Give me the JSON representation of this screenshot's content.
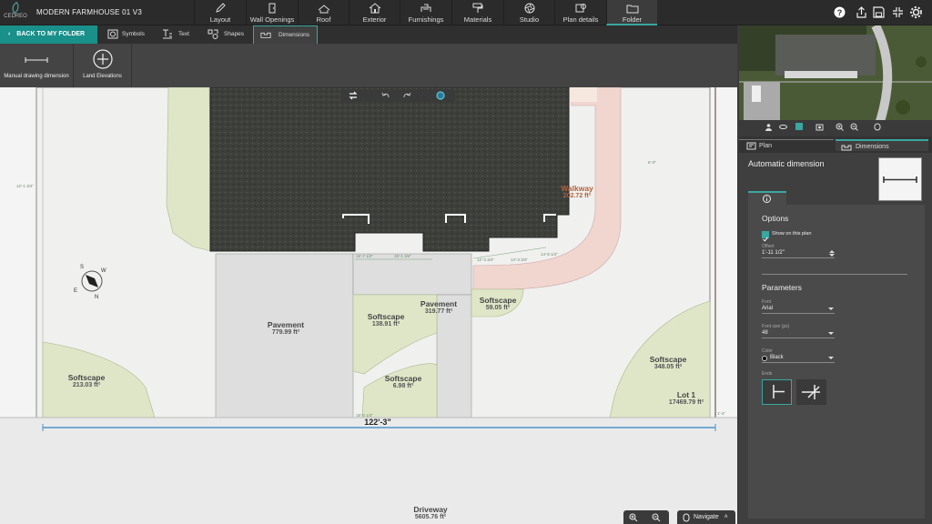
{
  "app": {
    "logo_text": "CEDREO",
    "project_name": "MODERN FARMHOUSE 01 V3"
  },
  "main_tabs": [
    {
      "label": "Layout",
      "icon": "pencil-icon"
    },
    {
      "label": "Wall Openings",
      "icon": "door-icon"
    },
    {
      "label": "Roof",
      "icon": "roof-icon"
    },
    {
      "label": "Exterior",
      "icon": "house-icon"
    },
    {
      "label": "Furnishings",
      "icon": "sofa-icon"
    },
    {
      "label": "Materials",
      "icon": "paint-roller-icon"
    },
    {
      "label": "Studio",
      "icon": "aperture-icon"
    },
    {
      "label": "Plan details",
      "icon": "plan-details-icon"
    },
    {
      "label": "Folder",
      "icon": "folder-icon",
      "active": true
    }
  ],
  "right_icons": [
    "help-icon",
    "share-icon",
    "save-icon",
    "collapse-icon",
    "settings-icon"
  ],
  "subbar": {
    "back_label": "BACK TO MY FOLDER",
    "tabs": [
      {
        "label": "Symbols",
        "icon": "symbols-icon"
      },
      {
        "label": "Text",
        "icon": "text-icon"
      },
      {
        "label": "Shapes",
        "icon": "shapes-icon"
      },
      {
        "label": "Dimensions",
        "icon": "dimensions-icon",
        "active": true
      }
    ]
  },
  "tools": [
    {
      "label": "Manual drawing dimension",
      "icon": "dimension-line-icon"
    },
    {
      "label": "Land Elevations",
      "icon": "plus-circle-icon"
    }
  ],
  "plan": {
    "labels": [
      {
        "name": "Walkway",
        "area": "202.72 ft²"
      },
      {
        "name": "Pavement",
        "area": "779.99 ft²"
      },
      {
        "name": "Softscape",
        "area": "138.91 ft²"
      },
      {
        "name": "Pavement",
        "area": "319.77 ft²"
      },
      {
        "name": "Softscape",
        "area": "59.05 ft²"
      },
      {
        "name": "Softscape",
        "area": "6.98 ft²"
      },
      {
        "name": "Softscape",
        "area": "348.05 ft²"
      },
      {
        "name": "Softscape",
        "area": "213.03 ft²"
      },
      {
        "name": "Lot 1",
        "area": "17469.79 ft²"
      },
      {
        "name": "Driveway",
        "area": "5605.76 ft²"
      }
    ],
    "dimension_main": "122'-3\"",
    "small_dims": [
      "12'-1 3/4\"",
      "15'-7 1/2\"",
      "15'-1 3/4\"",
      "14'-8 1/4\"",
      "14'-3 3/4\"",
      "6'-0\"",
      "12'-3 3/4\"",
      "15'-0 1/4\"",
      "1'-4\""
    ],
    "compass": {
      "s": "S",
      "w": "W",
      "e": "E",
      "n": "N"
    }
  },
  "canvas_controls": {
    "zoom_in": "zoom-in-icon",
    "zoom_out": "zoom-out-icon",
    "navigate_label": "Navigate"
  },
  "right_panel": {
    "tabs": [
      {
        "label": "Plan"
      },
      {
        "label": "Dimensions",
        "active": true
      }
    ],
    "title": "Automatic dimension",
    "options_title": "Options",
    "show_on_plan": "Show on this plan",
    "offset_label": "Offset",
    "offset_value": "1'-11 1/2\"",
    "parameters_title": "Parameters",
    "font_label": "Font",
    "font_value": "Arial",
    "font_size_label": "Font size (px)",
    "font_size_value": "48",
    "color_label": "Color",
    "color_value": "Black",
    "ends_label": "Ends"
  },
  "colors": {
    "accent": "#3aa7a0",
    "roof": "#3d3f3b",
    "softscape": "#dfe6c8",
    "pavement": "#dedede",
    "walkway": "#f0d6cf"
  }
}
